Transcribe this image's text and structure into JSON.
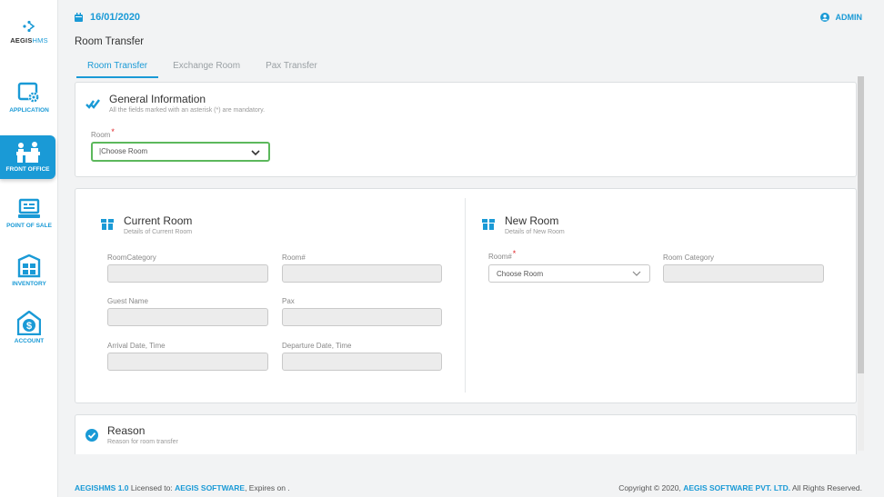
{
  "app": {
    "logo_prefix": "AEGIS",
    "logo_suffix": "HMS",
    "logo_icon": "aegis-logo-icon"
  },
  "sidebar": {
    "items": [
      {
        "label": "APPLICATION",
        "icon": "application-gear-icon"
      },
      {
        "label": "FRONT OFFICE",
        "icon": "front-office-reception-icon",
        "active": true
      },
      {
        "label": "POINT OF SALE",
        "icon": "point-of-sale-icon"
      },
      {
        "label": "INVENTORY",
        "icon": "inventory-icon"
      },
      {
        "label": "ACCOUNT",
        "icon": "account-dollar-icon"
      }
    ]
  },
  "header": {
    "date": "16/01/2020",
    "user": "ADMIN",
    "page_title": "Room Transfer"
  },
  "tabs": [
    {
      "label": "Room Transfer",
      "active": true
    },
    {
      "label": "Exchange Room"
    },
    {
      "label": "Pax Transfer"
    }
  ],
  "general": {
    "title": "General Information",
    "subtitle": "All the fields marked with an asterisk (*) are mandatory.",
    "room_label": "Room",
    "room_required": "*",
    "room_value": "|Choose Room"
  },
  "current_room": {
    "title": "Current Room",
    "subtitle": "Details of Current Room",
    "fields": {
      "category": "RoomCategory",
      "room_no": "Room#",
      "guest": "Guest Name",
      "pax": "Pax",
      "arrival": "Arrival Date, Time",
      "departure": "Departure Date, Time"
    }
  },
  "new_room": {
    "title": "New Room",
    "subtitle": "Details of New Room",
    "room_label": "Room#",
    "room_required": "*",
    "room_value": "Choose Room",
    "category_label": "Room Category"
  },
  "reason": {
    "title": "Reason",
    "subtitle": "Reason for room transfer"
  },
  "footer": {
    "version": "AEGISHMS 1.0",
    "licensed_to_text": " Licensed to: ",
    "licensee": "AEGIS SOFTWARE",
    "expires_text": ", Expires on .",
    "copyright_text": "Copyright © 2020, ",
    "company": "AEGIS SOFTWARE PVT. LTD.",
    "rights_text": " All Rights Reserved."
  },
  "colors": {
    "accent": "#1a9ad6",
    "required": "#e0262a",
    "focus": "#5cb85c"
  }
}
